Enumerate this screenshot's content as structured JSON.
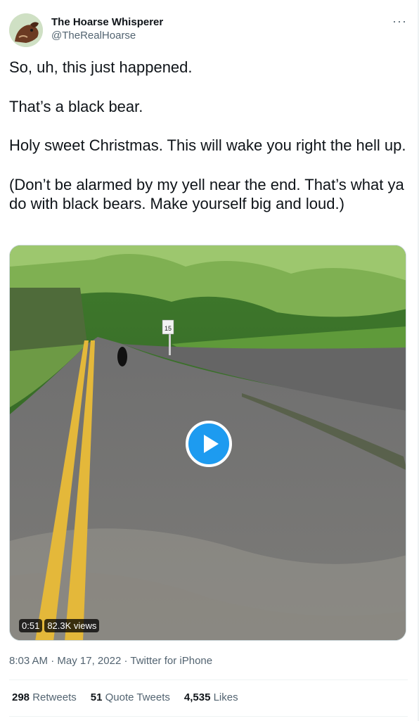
{
  "author": {
    "display_name": "The Hoarse Whisperer",
    "handle": "@TheRealHoarse",
    "avatar_icon": "horse-avatar"
  },
  "more_icon": "···",
  "tweet": {
    "paragraphs": [
      "So, uh, this just happened.",
      "That’s a black bear.",
      "Holy sweet Christmas. This will wake you right the hell up.",
      "(Don’t be alarmed by my yell near the end. That’s what ya do with black bears. Make yourself big and loud.)"
    ]
  },
  "media": {
    "duration": "0:51",
    "views": "82.3K views",
    "sign_text": "15",
    "play_icon": "play-icon"
  },
  "meta": {
    "time": "8:03 AM",
    "separator": "·",
    "date": "May 17, 2022",
    "source": "Twitter for iPhone"
  },
  "stats": {
    "retweets_count": "298",
    "retweets_label": "Retweets",
    "quotes_count": "51",
    "quotes_label": "Quote Tweets",
    "likes_count": "4,535",
    "likes_label": "Likes"
  },
  "colors": {
    "accent": "#1d9bf0",
    "secondary_text": "#536471",
    "primary_text": "#0f1419"
  }
}
